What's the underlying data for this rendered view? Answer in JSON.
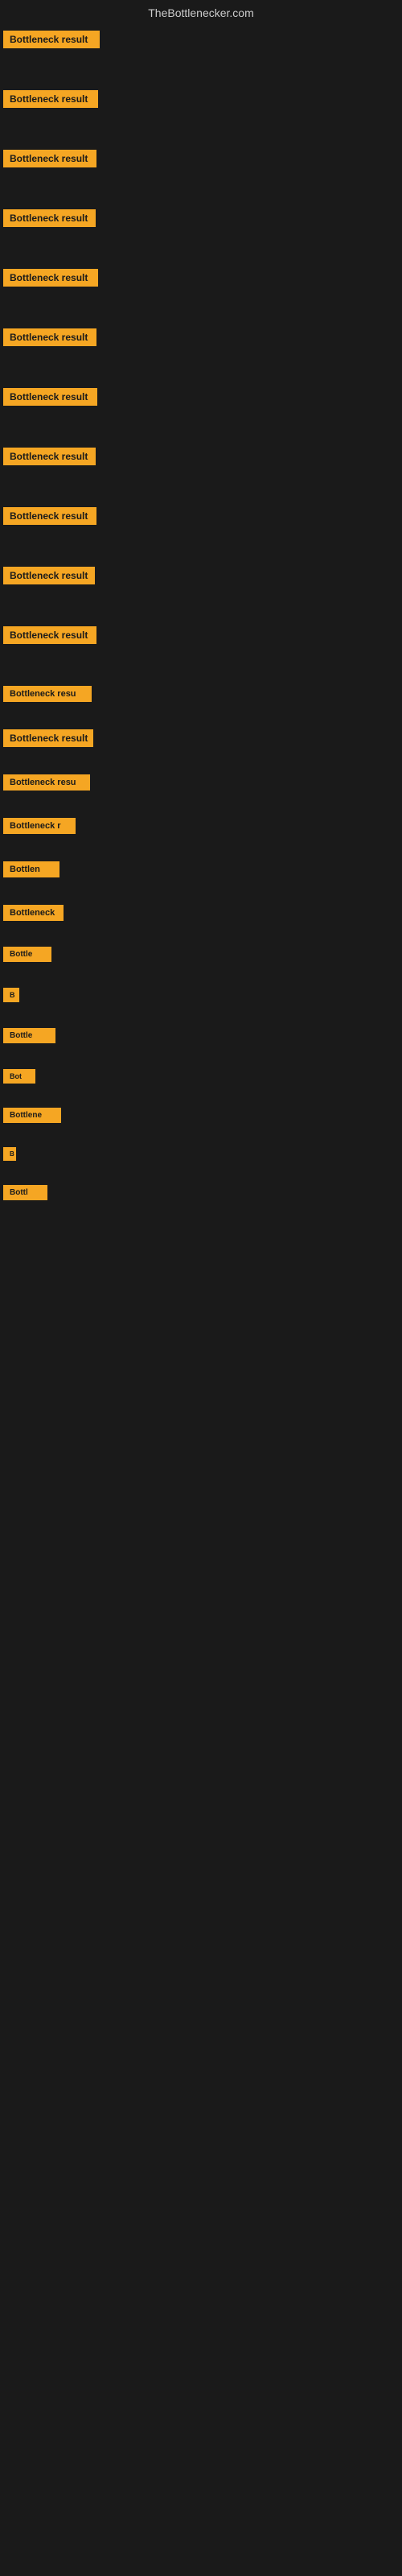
{
  "site": {
    "title": "TheBottlenecker.com"
  },
  "items": [
    {
      "id": 1,
      "label": "Bottleneck result",
      "class": "item-1"
    },
    {
      "id": 2,
      "label": "Bottleneck result",
      "class": "item-2"
    },
    {
      "id": 3,
      "label": "Bottleneck result",
      "class": "item-3"
    },
    {
      "id": 4,
      "label": "Bottleneck result",
      "class": "item-4"
    },
    {
      "id": 5,
      "label": "Bottleneck result",
      "class": "item-5"
    },
    {
      "id": 6,
      "label": "Bottleneck result",
      "class": "item-6"
    },
    {
      "id": 7,
      "label": "Bottleneck result",
      "class": "item-7"
    },
    {
      "id": 8,
      "label": "Bottleneck result",
      "class": "item-8"
    },
    {
      "id": 9,
      "label": "Bottleneck result",
      "class": "item-9"
    },
    {
      "id": 10,
      "label": "Bottleneck result",
      "class": "item-10"
    },
    {
      "id": 11,
      "label": "Bottleneck result",
      "class": "item-11"
    },
    {
      "id": 12,
      "label": "Bottleneck resu",
      "class": "item-12"
    },
    {
      "id": 13,
      "label": "Bottleneck result",
      "class": "item-13"
    },
    {
      "id": 14,
      "label": "Bottleneck resu",
      "class": "item-14"
    },
    {
      "id": 15,
      "label": "Bottleneck r",
      "class": "item-15"
    },
    {
      "id": 16,
      "label": "Bottlen",
      "class": "item-16"
    },
    {
      "id": 17,
      "label": "Bottleneck",
      "class": "item-17"
    },
    {
      "id": 18,
      "label": "Bottle",
      "class": "item-18"
    },
    {
      "id": 19,
      "label": "B",
      "class": "item-19"
    },
    {
      "id": 20,
      "label": "Bottle",
      "class": "item-20"
    },
    {
      "id": 21,
      "label": "Bot",
      "class": "item-21"
    },
    {
      "id": 22,
      "label": "Bottlene",
      "class": "item-22"
    },
    {
      "id": 23,
      "label": "B",
      "class": "item-23"
    },
    {
      "id": 24,
      "label": "Bottl",
      "class": "item-24"
    }
  ]
}
